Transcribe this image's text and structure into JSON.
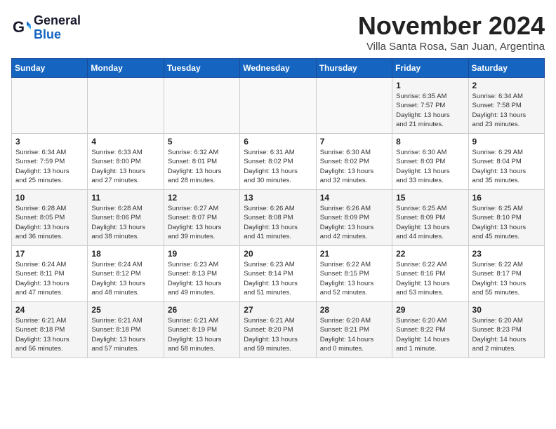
{
  "logo": {
    "line1": "General",
    "line2": "Blue"
  },
  "title": "November 2024",
  "subtitle": "Villa Santa Rosa, San Juan, Argentina",
  "header_days": [
    "Sunday",
    "Monday",
    "Tuesday",
    "Wednesday",
    "Thursday",
    "Friday",
    "Saturday"
  ],
  "weeks": [
    [
      {
        "day": "",
        "info": ""
      },
      {
        "day": "",
        "info": ""
      },
      {
        "day": "",
        "info": ""
      },
      {
        "day": "",
        "info": ""
      },
      {
        "day": "",
        "info": ""
      },
      {
        "day": "1",
        "info": "Sunrise: 6:35 AM\nSunset: 7:57 PM\nDaylight: 13 hours\nand 21 minutes."
      },
      {
        "day": "2",
        "info": "Sunrise: 6:34 AM\nSunset: 7:58 PM\nDaylight: 13 hours\nand 23 minutes."
      }
    ],
    [
      {
        "day": "3",
        "info": "Sunrise: 6:34 AM\nSunset: 7:59 PM\nDaylight: 13 hours\nand 25 minutes."
      },
      {
        "day": "4",
        "info": "Sunrise: 6:33 AM\nSunset: 8:00 PM\nDaylight: 13 hours\nand 27 minutes."
      },
      {
        "day": "5",
        "info": "Sunrise: 6:32 AM\nSunset: 8:01 PM\nDaylight: 13 hours\nand 28 minutes."
      },
      {
        "day": "6",
        "info": "Sunrise: 6:31 AM\nSunset: 8:02 PM\nDaylight: 13 hours\nand 30 minutes."
      },
      {
        "day": "7",
        "info": "Sunrise: 6:30 AM\nSunset: 8:02 PM\nDaylight: 13 hours\nand 32 minutes."
      },
      {
        "day": "8",
        "info": "Sunrise: 6:30 AM\nSunset: 8:03 PM\nDaylight: 13 hours\nand 33 minutes."
      },
      {
        "day": "9",
        "info": "Sunrise: 6:29 AM\nSunset: 8:04 PM\nDaylight: 13 hours\nand 35 minutes."
      }
    ],
    [
      {
        "day": "10",
        "info": "Sunrise: 6:28 AM\nSunset: 8:05 PM\nDaylight: 13 hours\nand 36 minutes."
      },
      {
        "day": "11",
        "info": "Sunrise: 6:28 AM\nSunset: 8:06 PM\nDaylight: 13 hours\nand 38 minutes."
      },
      {
        "day": "12",
        "info": "Sunrise: 6:27 AM\nSunset: 8:07 PM\nDaylight: 13 hours\nand 39 minutes."
      },
      {
        "day": "13",
        "info": "Sunrise: 6:26 AM\nSunset: 8:08 PM\nDaylight: 13 hours\nand 41 minutes."
      },
      {
        "day": "14",
        "info": "Sunrise: 6:26 AM\nSunset: 8:09 PM\nDaylight: 13 hours\nand 42 minutes."
      },
      {
        "day": "15",
        "info": "Sunrise: 6:25 AM\nSunset: 8:09 PM\nDaylight: 13 hours\nand 44 minutes."
      },
      {
        "day": "16",
        "info": "Sunrise: 6:25 AM\nSunset: 8:10 PM\nDaylight: 13 hours\nand 45 minutes."
      }
    ],
    [
      {
        "day": "17",
        "info": "Sunrise: 6:24 AM\nSunset: 8:11 PM\nDaylight: 13 hours\nand 47 minutes."
      },
      {
        "day": "18",
        "info": "Sunrise: 6:24 AM\nSunset: 8:12 PM\nDaylight: 13 hours\nand 48 minutes."
      },
      {
        "day": "19",
        "info": "Sunrise: 6:23 AM\nSunset: 8:13 PM\nDaylight: 13 hours\nand 49 minutes."
      },
      {
        "day": "20",
        "info": "Sunrise: 6:23 AM\nSunset: 8:14 PM\nDaylight: 13 hours\nand 51 minutes."
      },
      {
        "day": "21",
        "info": "Sunrise: 6:22 AM\nSunset: 8:15 PM\nDaylight: 13 hours\nand 52 minutes."
      },
      {
        "day": "22",
        "info": "Sunrise: 6:22 AM\nSunset: 8:16 PM\nDaylight: 13 hours\nand 53 minutes."
      },
      {
        "day": "23",
        "info": "Sunrise: 6:22 AM\nSunset: 8:17 PM\nDaylight: 13 hours\nand 55 minutes."
      }
    ],
    [
      {
        "day": "24",
        "info": "Sunrise: 6:21 AM\nSunset: 8:18 PM\nDaylight: 13 hours\nand 56 minutes."
      },
      {
        "day": "25",
        "info": "Sunrise: 6:21 AM\nSunset: 8:18 PM\nDaylight: 13 hours\nand 57 minutes."
      },
      {
        "day": "26",
        "info": "Sunrise: 6:21 AM\nSunset: 8:19 PM\nDaylight: 13 hours\nand 58 minutes."
      },
      {
        "day": "27",
        "info": "Sunrise: 6:21 AM\nSunset: 8:20 PM\nDaylight: 13 hours\nand 59 minutes."
      },
      {
        "day": "28",
        "info": "Sunrise: 6:20 AM\nSunset: 8:21 PM\nDaylight: 14 hours\nand 0 minutes."
      },
      {
        "day": "29",
        "info": "Sunrise: 6:20 AM\nSunset: 8:22 PM\nDaylight: 14 hours\nand 1 minute."
      },
      {
        "day": "30",
        "info": "Sunrise: 6:20 AM\nSunset: 8:23 PM\nDaylight: 14 hours\nand 2 minutes."
      }
    ]
  ]
}
